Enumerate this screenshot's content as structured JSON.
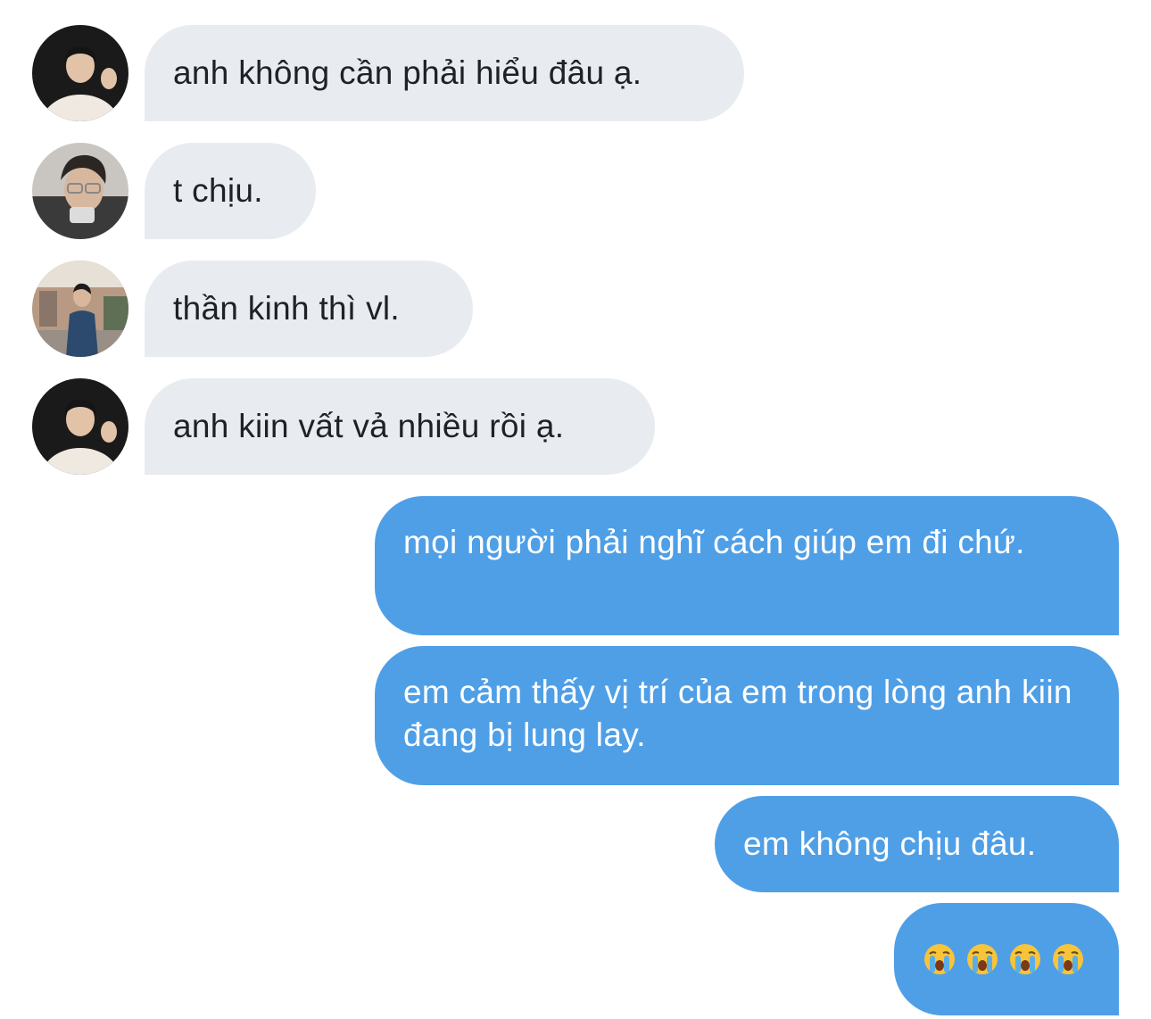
{
  "colors": {
    "incoming_bubble": "#e8ecf0",
    "outgoing_bubble": "#4f9fe7",
    "incoming_text": "#1d2226",
    "outgoing_text": "#ffffff"
  },
  "messages": [
    {
      "direction": "incoming",
      "avatar": "avatar-photo-1",
      "text": "anh không cần phải hiểu đâu ạ."
    },
    {
      "direction": "incoming",
      "avatar": "avatar-photo-2",
      "text": "t chịu."
    },
    {
      "direction": "incoming",
      "avatar": "avatar-photo-3",
      "text": "thần kinh thì vl."
    },
    {
      "direction": "incoming",
      "avatar": "avatar-photo-1",
      "text": "anh kiin vất vả nhiều rồi ạ."
    },
    {
      "direction": "outgoing",
      "text": "mọi người phải nghĩ cách giúp em đi chứ."
    },
    {
      "direction": "outgoing",
      "text": "em cảm thấy vị trí của em trong lòng anh kiin đang bị lung lay."
    },
    {
      "direction": "outgoing",
      "text": "em không chịu đâu."
    },
    {
      "direction": "outgoing",
      "emoji": [
        "loudly-crying-face",
        "loudly-crying-face",
        "loudly-crying-face",
        "loudly-crying-face"
      ]
    }
  ]
}
